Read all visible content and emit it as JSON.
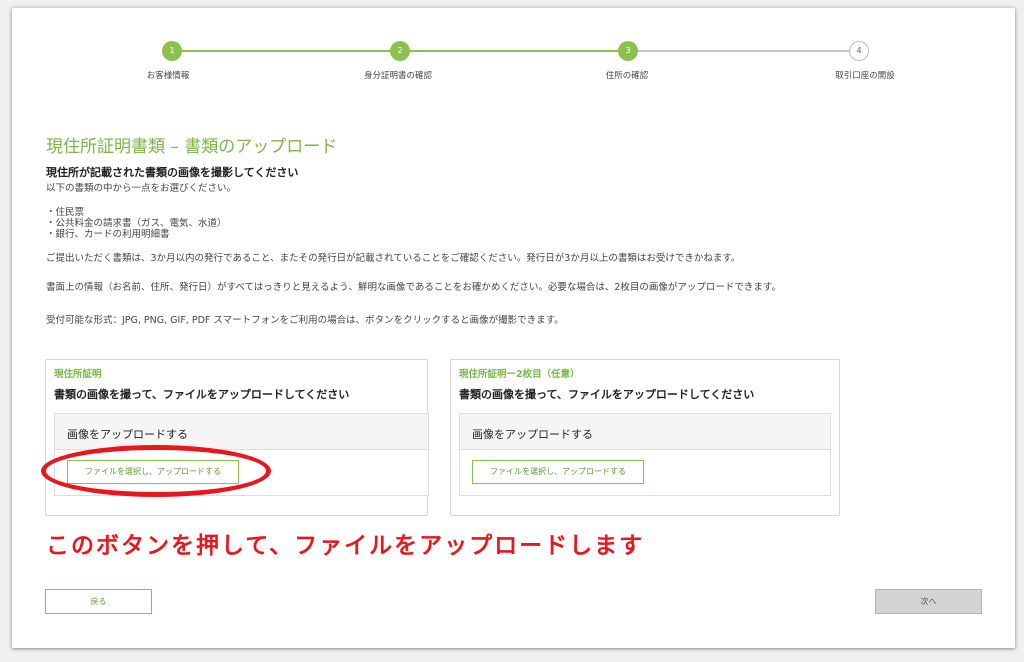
{
  "stepper": {
    "steps": [
      {
        "number": "1",
        "label": "お客様情報",
        "state": "done"
      },
      {
        "number": "2",
        "label": "身分証明書の確認",
        "state": "done"
      },
      {
        "number": "3",
        "label": "住所の確認",
        "state": "done"
      },
      {
        "number": "4",
        "label": "取引口座の開設",
        "state": "todo"
      }
    ],
    "colors": {
      "active": "#8dc14f",
      "inactive": "#bdbdbd"
    }
  },
  "page": {
    "title": "現住所証明書類 – 書類のアップロード",
    "subtitle": "現住所が記載された書類の画像を撮影してください",
    "intro": "以下の書類の中から一点をお選びください。",
    "documents": [
      "・住民票",
      "・公共料金の請求書（ガス、電気、水道）",
      "・銀行、カードの利用明細書"
    ],
    "notes": [
      "ご提出いただく書類は、3か月以内の発行であること、またその発行日が記載されていることをご確認ください。発行日が3か月以上の書類はお受けできかねます。",
      "書面上の情報（お名前、住所、発行日）がすべてはっきりと見えるよう、鮮明な画像であることをお確かめください。必要な場合は、2枚目の画像がアップロードできます。",
      "受付可能な形式：JPG, PNG, GIF, PDF スマートフォンをご利用の場合は、ボタンをクリックすると画像が撮影できます。"
    ]
  },
  "cards": [
    {
      "label": "現住所証明",
      "instruction": "書類の画像を撮って、ファイルをアップロードしてください",
      "upload_header": "画像をアップロードする",
      "button": "ファイルを選択し、アップロードする"
    },
    {
      "label": "現住所証明ー2枚目（任意）",
      "instruction": "書類の画像を撮って、ファイルをアップロードしてください",
      "upload_header": "画像をアップロードする",
      "button": "ファイルを選択し、アップロードする"
    }
  ],
  "annotation": {
    "text": "このボタンを押して、ファイルをアップロードします",
    "color": "#e8171f"
  },
  "footer": {
    "back": "戻る",
    "next": "次へ"
  },
  "theme": {
    "accent": "#7ab648",
    "button_border": "#8dc14f"
  }
}
